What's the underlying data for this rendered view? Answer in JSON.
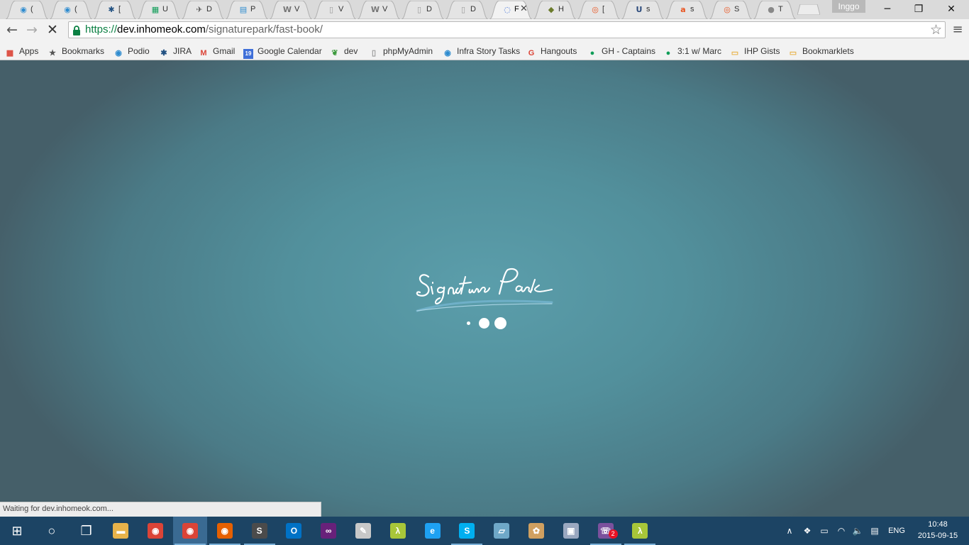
{
  "window": {
    "profile_name": "Inggo",
    "min_icon": "─",
    "max_icon": "❐",
    "close_icon": "✕"
  },
  "tabs": [
    {
      "title": "(",
      "icon": "podio-icon",
      "glyph": "◉",
      "color": "#2d8bcf"
    },
    {
      "title": "(",
      "icon": "podio-icon",
      "glyph": "◉",
      "color": "#2d8bcf"
    },
    {
      "title": "[",
      "icon": "jira-icon",
      "glyph": "✱",
      "color": "#205081"
    },
    {
      "title": "U",
      "icon": "sheets-icon",
      "glyph": "▦",
      "color": "#0f9d58"
    },
    {
      "title": "D",
      "icon": "flight-icon",
      "glyph": "✈",
      "color": "#555555"
    },
    {
      "title": "P",
      "icon": "slides-icon",
      "glyph": "▤",
      "color": "#2d8bcf"
    },
    {
      "title": "V",
      "icon": "wordpress-icon",
      "glyph": "W",
      "color": "#777777"
    },
    {
      "title": "V",
      "icon": "page-icon",
      "glyph": "▯",
      "color": "#999999"
    },
    {
      "title": "V",
      "icon": "wordpress-icon",
      "glyph": "W",
      "color": "#777777"
    },
    {
      "title": "D",
      "icon": "page-icon",
      "glyph": "▯",
      "color": "#999999"
    },
    {
      "title": "D",
      "icon": "page-icon",
      "glyph": "▯",
      "color": "#999999"
    },
    {
      "title": "F",
      "icon": "loading-spinner-icon",
      "glyph": "◌",
      "color": "#3367d6",
      "active": true
    },
    {
      "title": "H",
      "icon": "shipit-icon",
      "glyph": "◆",
      "color": "#6b7b2b"
    },
    {
      "title": "[",
      "icon": "ubuntu-icon",
      "glyph": "◎",
      "color": "#e95420"
    },
    {
      "title": "s",
      "icon": "ul-icon",
      "glyph": "U",
      "color": "#2c4b7c"
    },
    {
      "title": "s",
      "icon": "askubuntu-icon",
      "glyph": "a",
      "color": "#e95420"
    },
    {
      "title": "S",
      "icon": "ubuntu-icon",
      "glyph": "◎",
      "color": "#e95420"
    },
    {
      "title": "T",
      "icon": "circle-grey-icon",
      "glyph": "●",
      "color": "#888888"
    }
  ],
  "toolbar": {
    "back": "←",
    "forward": "→",
    "stop": "✕",
    "star": "☆",
    "menu": "≡",
    "url_scheme": "https://",
    "url_host": "dev.inhomeok.com",
    "url_path": "/signaturepark/fast-book/"
  },
  "bookmarks": [
    {
      "label": "Apps",
      "icon": "apps-grid-icon",
      "glyph": "▦",
      "color": "#db4437"
    },
    {
      "label": "Bookmarks",
      "icon": "star-icon",
      "glyph": "★",
      "color": "#555555"
    },
    {
      "label": "Podio",
      "icon": "podio-icon",
      "glyph": "◉",
      "color": "#2d8bcf"
    },
    {
      "label": "JIRA",
      "icon": "jira-icon",
      "glyph": "✱",
      "color": "#205081"
    },
    {
      "label": "Gmail",
      "icon": "gmail-icon",
      "glyph": "M",
      "color": "#db4437"
    },
    {
      "label": "Google Calendar",
      "icon": "calendar-icon",
      "glyph": "19",
      "color": "#3f6fd8"
    },
    {
      "label": "dev",
      "icon": "leaf-icon",
      "glyph": "❦",
      "color": "#3c9a3c"
    },
    {
      "label": "phpMyAdmin",
      "icon": "page-icon",
      "glyph": "▯",
      "color": "#999999"
    },
    {
      "label": "Infra Story Tasks",
      "icon": "podio-icon",
      "glyph": "◉",
      "color": "#2d8bcf"
    },
    {
      "label": "Hangouts",
      "icon": "google-plus-icon",
      "glyph": "G",
      "color": "#db4437"
    },
    {
      "label": "GH - Captains",
      "icon": "hangouts-icon",
      "glyph": "●",
      "color": "#0f9d58"
    },
    {
      "label": "3:1 w/ Marc",
      "icon": "hangouts-icon",
      "glyph": "●",
      "color": "#0f9d58"
    },
    {
      "label": "IHP Gists",
      "icon": "folder-icon",
      "glyph": "▭",
      "color": "#e8b34a"
    },
    {
      "label": "Bookmarklets",
      "icon": "folder-icon",
      "glyph": "▭",
      "color": "#e8b34a"
    }
  ],
  "page": {
    "logo_text": "Signature Park",
    "status_text": "Waiting for dev.inhomeok.com..."
  },
  "taskbar": {
    "apps": [
      {
        "name": "start-button",
        "glyph": "⊞",
        "color": "#1c4464"
      },
      {
        "name": "cortana-button",
        "glyph": "○",
        "color": "#1c4464"
      },
      {
        "name": "task-view-button",
        "glyph": "❐",
        "color": "#1c4464"
      },
      {
        "name": "file-explorer-icon",
        "glyph": "▬",
        "color": "#e8b34a",
        "open": false
      },
      {
        "name": "chrome-icon",
        "glyph": "◉",
        "color": "#db4437",
        "open": false
      },
      {
        "name": "chrome-icon",
        "glyph": "◉",
        "color": "#db4437",
        "open": true,
        "active": true
      },
      {
        "name": "firefox-icon",
        "glyph": "◉",
        "color": "#e66000",
        "open": true
      },
      {
        "name": "sublime-text-icon",
        "glyph": "S",
        "color": "#4b4b4b",
        "open": true
      },
      {
        "name": "outlook-icon",
        "glyph": "O",
        "color": "#0072c6",
        "open": false
      },
      {
        "name": "visual-studio-icon",
        "glyph": "∞",
        "color": "#68217a",
        "open": false
      },
      {
        "name": "paint-icon",
        "glyph": "✎",
        "color": "#c8c8c8",
        "open": false
      },
      {
        "name": "lambda-app-icon",
        "glyph": "λ",
        "color": "#a8c639",
        "open": false
      },
      {
        "name": "internet-explorer-icon",
        "glyph": "e",
        "color": "#1ea1f2",
        "open": false
      },
      {
        "name": "skype-icon",
        "glyph": "S",
        "color": "#00aff0",
        "open": true
      },
      {
        "name": "notepad-icon",
        "glyph": "▱",
        "color": "#6fa8c8",
        "open": false
      },
      {
        "name": "paint-palette-icon",
        "glyph": "✿",
        "color": "#d0a060",
        "open": false
      },
      {
        "name": "virtualbox-icon",
        "glyph": "▣",
        "color": "#9aa8c0",
        "open": false
      },
      {
        "name": "viber-icon",
        "glyph": "☏",
        "color": "#7b519d",
        "open": true,
        "badge": "2"
      },
      {
        "name": "terminal-app-icon",
        "glyph": "λ",
        "color": "#a8c639",
        "open": true
      }
    ],
    "tray": {
      "chevron": "∧",
      "dropbox": "❖",
      "battery": "▭",
      "wifi": "◠",
      "volume": "🔈",
      "notifications": "▤",
      "language": "ENG"
    },
    "clock_time": "10:48",
    "clock_date": "2015-09-15"
  }
}
